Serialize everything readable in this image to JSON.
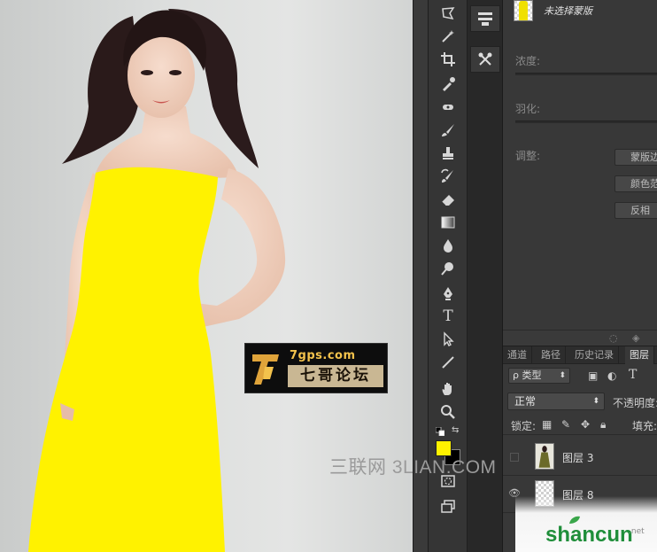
{
  "canvas": {
    "dress_color": "#fff200",
    "watermark": {
      "url": "7gps.com",
      "name": "七哥论坛"
    },
    "overlay_text": "三联网 3LIAN.COM"
  },
  "toolbar": {
    "tools": [
      "lasso-icon",
      "magic-wand-icon",
      "crop-icon",
      "eyedropper-icon",
      "healing-brush-icon",
      "brush-icon",
      "clone-stamp-icon",
      "history-brush-icon",
      "eraser-icon",
      "gradient-icon",
      "blur-icon",
      "dodge-icon",
      "pen-icon",
      "type-icon",
      "path-selection-icon",
      "line-icon",
      "hand-icon",
      "zoom-icon"
    ],
    "type_glyph": "T",
    "foreground_color": "#fff200",
    "background_color": "#000000"
  },
  "properties": {
    "mask_name": "未选择蒙版",
    "density_label": "浓度:",
    "feather_label": "羽化:",
    "adjust_label": "调整:",
    "buttons": [
      "蒙版边缘...",
      "颜色范围...",
      "反相"
    ]
  },
  "layers_panel": {
    "tabs": [
      "通道",
      "路径",
      "历史记录",
      "图层"
    ],
    "active_tab": "图层",
    "filter_label": "ρ 类型",
    "type_filter_glyph": "T",
    "blend_mode": "正常",
    "opacity_label": "不透明度:",
    "lock_label": "锁定:",
    "fill_label": "填充:",
    "layers": [
      {
        "name": "图层 3",
        "visible": false
      },
      {
        "name": "图层 8",
        "visible": true
      }
    ]
  },
  "watermarks": {
    "shancun": "shancun",
    "shancun_sub": ".net"
  }
}
